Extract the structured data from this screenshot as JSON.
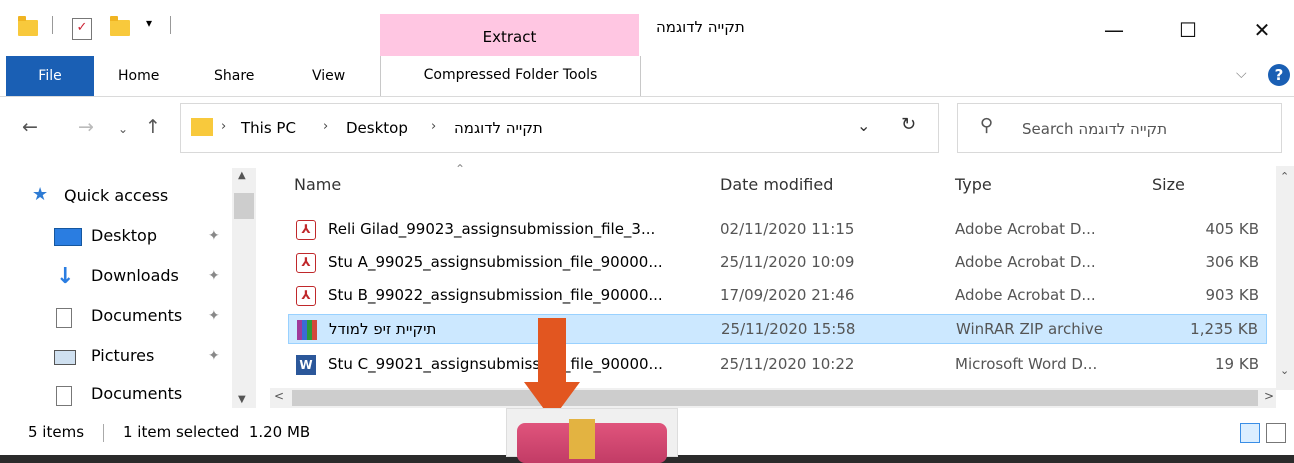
{
  "window": {
    "title": "תקייה לדוגמה",
    "extract_tab": "Extract",
    "controls": {
      "minimize": "—",
      "maximize": "☐",
      "close": "✕"
    }
  },
  "ribbon": {
    "tabs": {
      "file": "File",
      "home": "Home",
      "share": "Share",
      "view": "View"
    },
    "context_tab": "Compressed Folder Tools",
    "help": "?"
  },
  "address": {
    "crumbs": [
      "This PC",
      "Desktop",
      "תקייה לדוגמה"
    ],
    "search_placeholder": "Search תקייה לדוגמה"
  },
  "nav": {
    "items": [
      {
        "label": "Quick access",
        "icon": "star-icon",
        "pinned": false
      },
      {
        "label": "Desktop",
        "icon": "desktop-icon",
        "pinned": true
      },
      {
        "label": "Downloads",
        "icon": "download-arrow-icon",
        "pinned": true
      },
      {
        "label": "Documents",
        "icon": "documents-icon",
        "pinned": true
      },
      {
        "label": "Pictures",
        "icon": "pictures-icon",
        "pinned": true
      },
      {
        "label": "Documents",
        "icon": "documents-icon",
        "pinned": false
      }
    ]
  },
  "columns": {
    "name": "Name",
    "date": "Date modified",
    "type": "Type",
    "size": "Size"
  },
  "files": [
    {
      "name": "Reli Gilad_99023_assignsubmission_file_3...",
      "date": "02/11/2020 11:15",
      "type": "Adobe Acrobat D...",
      "size": "405 KB",
      "icon": "pdf-icon"
    },
    {
      "name": "Stu A_99025_assignsubmission_file_90000...",
      "date": "25/11/2020 10:09",
      "type": "Adobe Acrobat D...",
      "size": "306 KB",
      "icon": "pdf-icon"
    },
    {
      "name": "Stu B_99022_assignsubmission_file_90000...",
      "date": "17/09/2020 21:46",
      "type": "Adobe Acrobat D...",
      "size": "903 KB",
      "icon": "pdf-icon"
    },
    {
      "name": "תיקיית זיפ למודל",
      "date": "25/11/2020 15:58",
      "type": "WinRAR ZIP archive",
      "size": "1,235 KB",
      "icon": "winrar-icon",
      "selected": true
    },
    {
      "name": "Stu C_99021_assignsubmission_file_90000...",
      "date": "25/11/2020 10:22",
      "type": "Microsoft Word D...",
      "size": "19 KB",
      "icon": "word-doc-icon"
    }
  ],
  "status": {
    "count": "5 items",
    "selection": "1 item selected  1.20 MB"
  },
  "colors": {
    "accent": "#1a5fb4",
    "extract_tab": "#ffc6e2",
    "selection": "#cce8ff",
    "arrow": "#e25620"
  }
}
